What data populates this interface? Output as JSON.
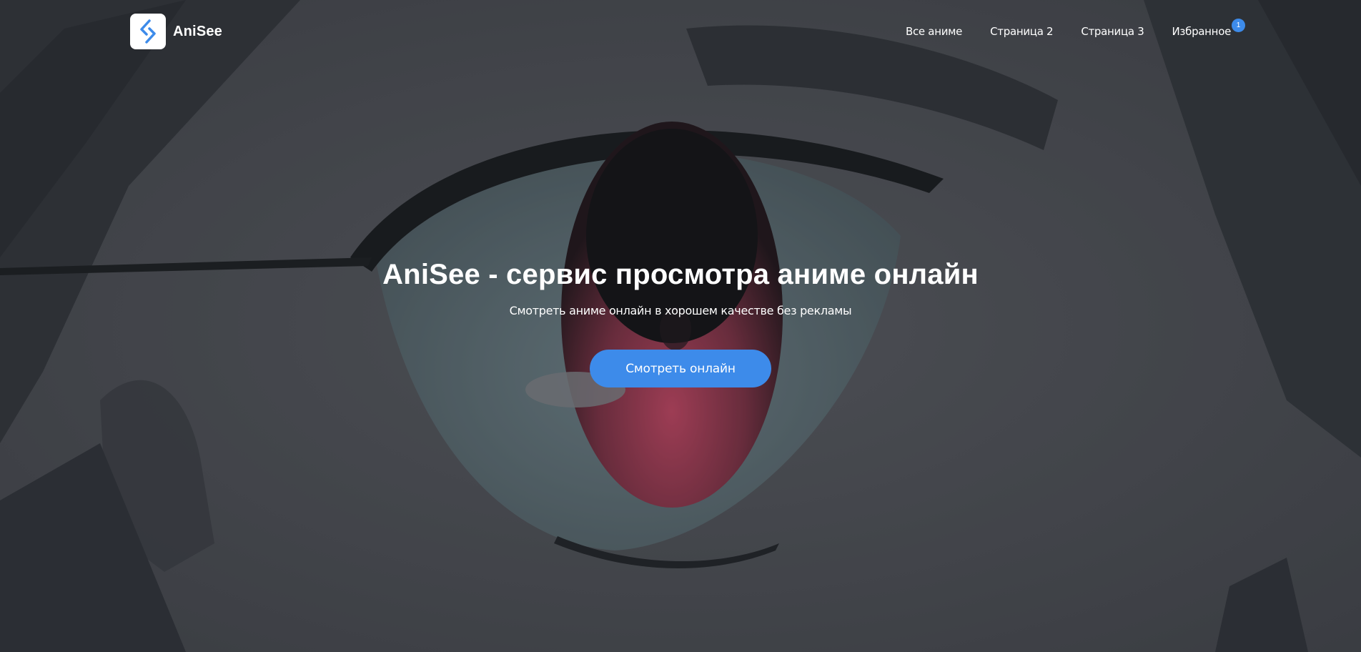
{
  "colors": {
    "accent": "#3d8bea",
    "overlay": "#3b3e45",
    "text": "#ffffff"
  },
  "header": {
    "logo_icon": "anisee-logo-icon",
    "logo_text": "AniSee",
    "nav": [
      {
        "label": "Все аниме"
      },
      {
        "label": "Страница 2"
      },
      {
        "label": "Страница 3"
      },
      {
        "label": "Избранное",
        "badge": "1"
      }
    ]
  },
  "hero": {
    "background": "anime-eye-closeup",
    "title": "AniSee - сервис просмотра аниме онлайн",
    "subtitle": "Смотреть аниме онлайн в хорошем качестве без рекламы",
    "button_label": "Смотреть онлайн"
  }
}
